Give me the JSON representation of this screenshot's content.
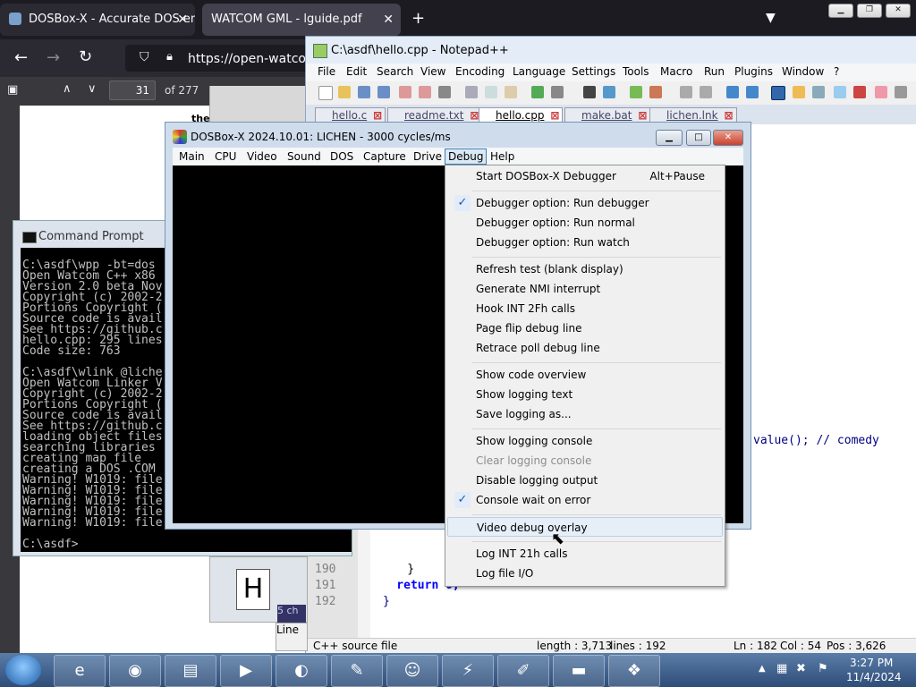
{
  "browser": {
    "tabs": [
      {
        "label": "DOSBox-X - Accurate DOS emu"
      },
      {
        "label": "WATCOM GML - lguide.pdf"
      }
    ],
    "url": "https://open-watcom",
    "pdf": {
      "page": "31",
      "of": "of 277"
    },
    "content_fragment": "the"
  },
  "notepad": {
    "title": "C:\\asdf\\hello.cpp - Notepad++",
    "menu": [
      "File",
      "Edit",
      "Search",
      "View",
      "Encoding",
      "Language",
      "Settings",
      "Tools",
      "Macro",
      "Run",
      "Plugins",
      "Window",
      "?"
    ],
    "tabs": [
      {
        "label": "hello.c"
      },
      {
        "label": "readme.txt"
      },
      {
        "label": "hello.cpp",
        "active": true
      },
      {
        "label": "make.bat"
      },
      {
        "label": "lichen.lnk"
      }
    ],
    "line_numbers": [
      "190",
      "191",
      "192"
    ],
    "code_line_190": "    }",
    "code_line_191": "    return 0;",
    "code_line_192": "}",
    "code_fragment_right": "value(); // comedy",
    "status": {
      "type": "C++ source file",
      "length": "length : 3,713",
      "lines": "lines : 192",
      "ln": "Ln : 182",
      "col": "Col : 54",
      "pos": "Pos : 3,626"
    }
  },
  "cmd": {
    "title": "Command Prompt",
    "lines": [
      "C:\\asdf\\wpp -bt=dos",
      "Open Watcom C++ x86",
      "Version 2.0 beta Nov",
      "Copyright (c) 2002-2",
      "Portions Copyright (",
      "Source code is avail",
      "See https://github.c",
      "hello.cpp: 295 lines",
      "Code size: 763",
      "",
      "C:\\asdf\\wlink @liche",
      "Open Watcom Linker V",
      "Copyright (c) 2002-2",
      "Portions Copyright (",
      "Source code is avail",
      "See https://github.c",
      "loading object files",
      "searching libraries",
      "creating map file",
      "creating a DOS .COM",
      "Warning! W1019: file",
      "Warning! W1019: file",
      "Warning! W1019: file",
      "Warning! W1019: file",
      "Warning! W1019: file",
      "",
      "C:\\asdf>"
    ]
  },
  "behind": {
    "frag_ch": "5 ch",
    "frag_line": "Line"
  },
  "dosbox": {
    "title": "DOSBox-X 2024.10.01: LICHEN - 3000 cycles/ms",
    "menu": [
      "Main",
      "CPU",
      "Video",
      "Sound",
      "DOS",
      "Capture",
      "Drive",
      "Debug",
      "Help"
    ],
    "open_menu": "Debug",
    "debug_menu": [
      {
        "label": "Start DOSBox-X Debugger",
        "shortcut": "Alt+Pause"
      },
      {
        "sep": true
      },
      {
        "label": "Debugger option: Run debugger",
        "checked": true
      },
      {
        "label": "Debugger option: Run normal"
      },
      {
        "label": "Debugger option: Run watch"
      },
      {
        "sep": true
      },
      {
        "label": "Refresh test (blank display)"
      },
      {
        "label": "Generate NMI interrupt"
      },
      {
        "label": "Hook INT 2Fh calls"
      },
      {
        "label": "Page flip debug line"
      },
      {
        "label": "Retrace poll debug line"
      },
      {
        "sep": true
      },
      {
        "label": "Show code overview"
      },
      {
        "label": "Show logging text"
      },
      {
        "label": "Save logging as..."
      },
      {
        "sep": true
      },
      {
        "label": "Show logging console"
      },
      {
        "label": "Clear logging console",
        "disabled": true
      },
      {
        "label": "Disable logging output"
      },
      {
        "label": "Console wait on error",
        "checked": true
      },
      {
        "sep": true
      },
      {
        "label": "Video debug overlay",
        "highlighted": true
      },
      {
        "sep": true
      },
      {
        "label": "Log INT 21h calls"
      },
      {
        "label": "Log file I/O"
      }
    ]
  },
  "taskbar": {
    "time": "3:27 PM",
    "date": "11/4/2024"
  }
}
